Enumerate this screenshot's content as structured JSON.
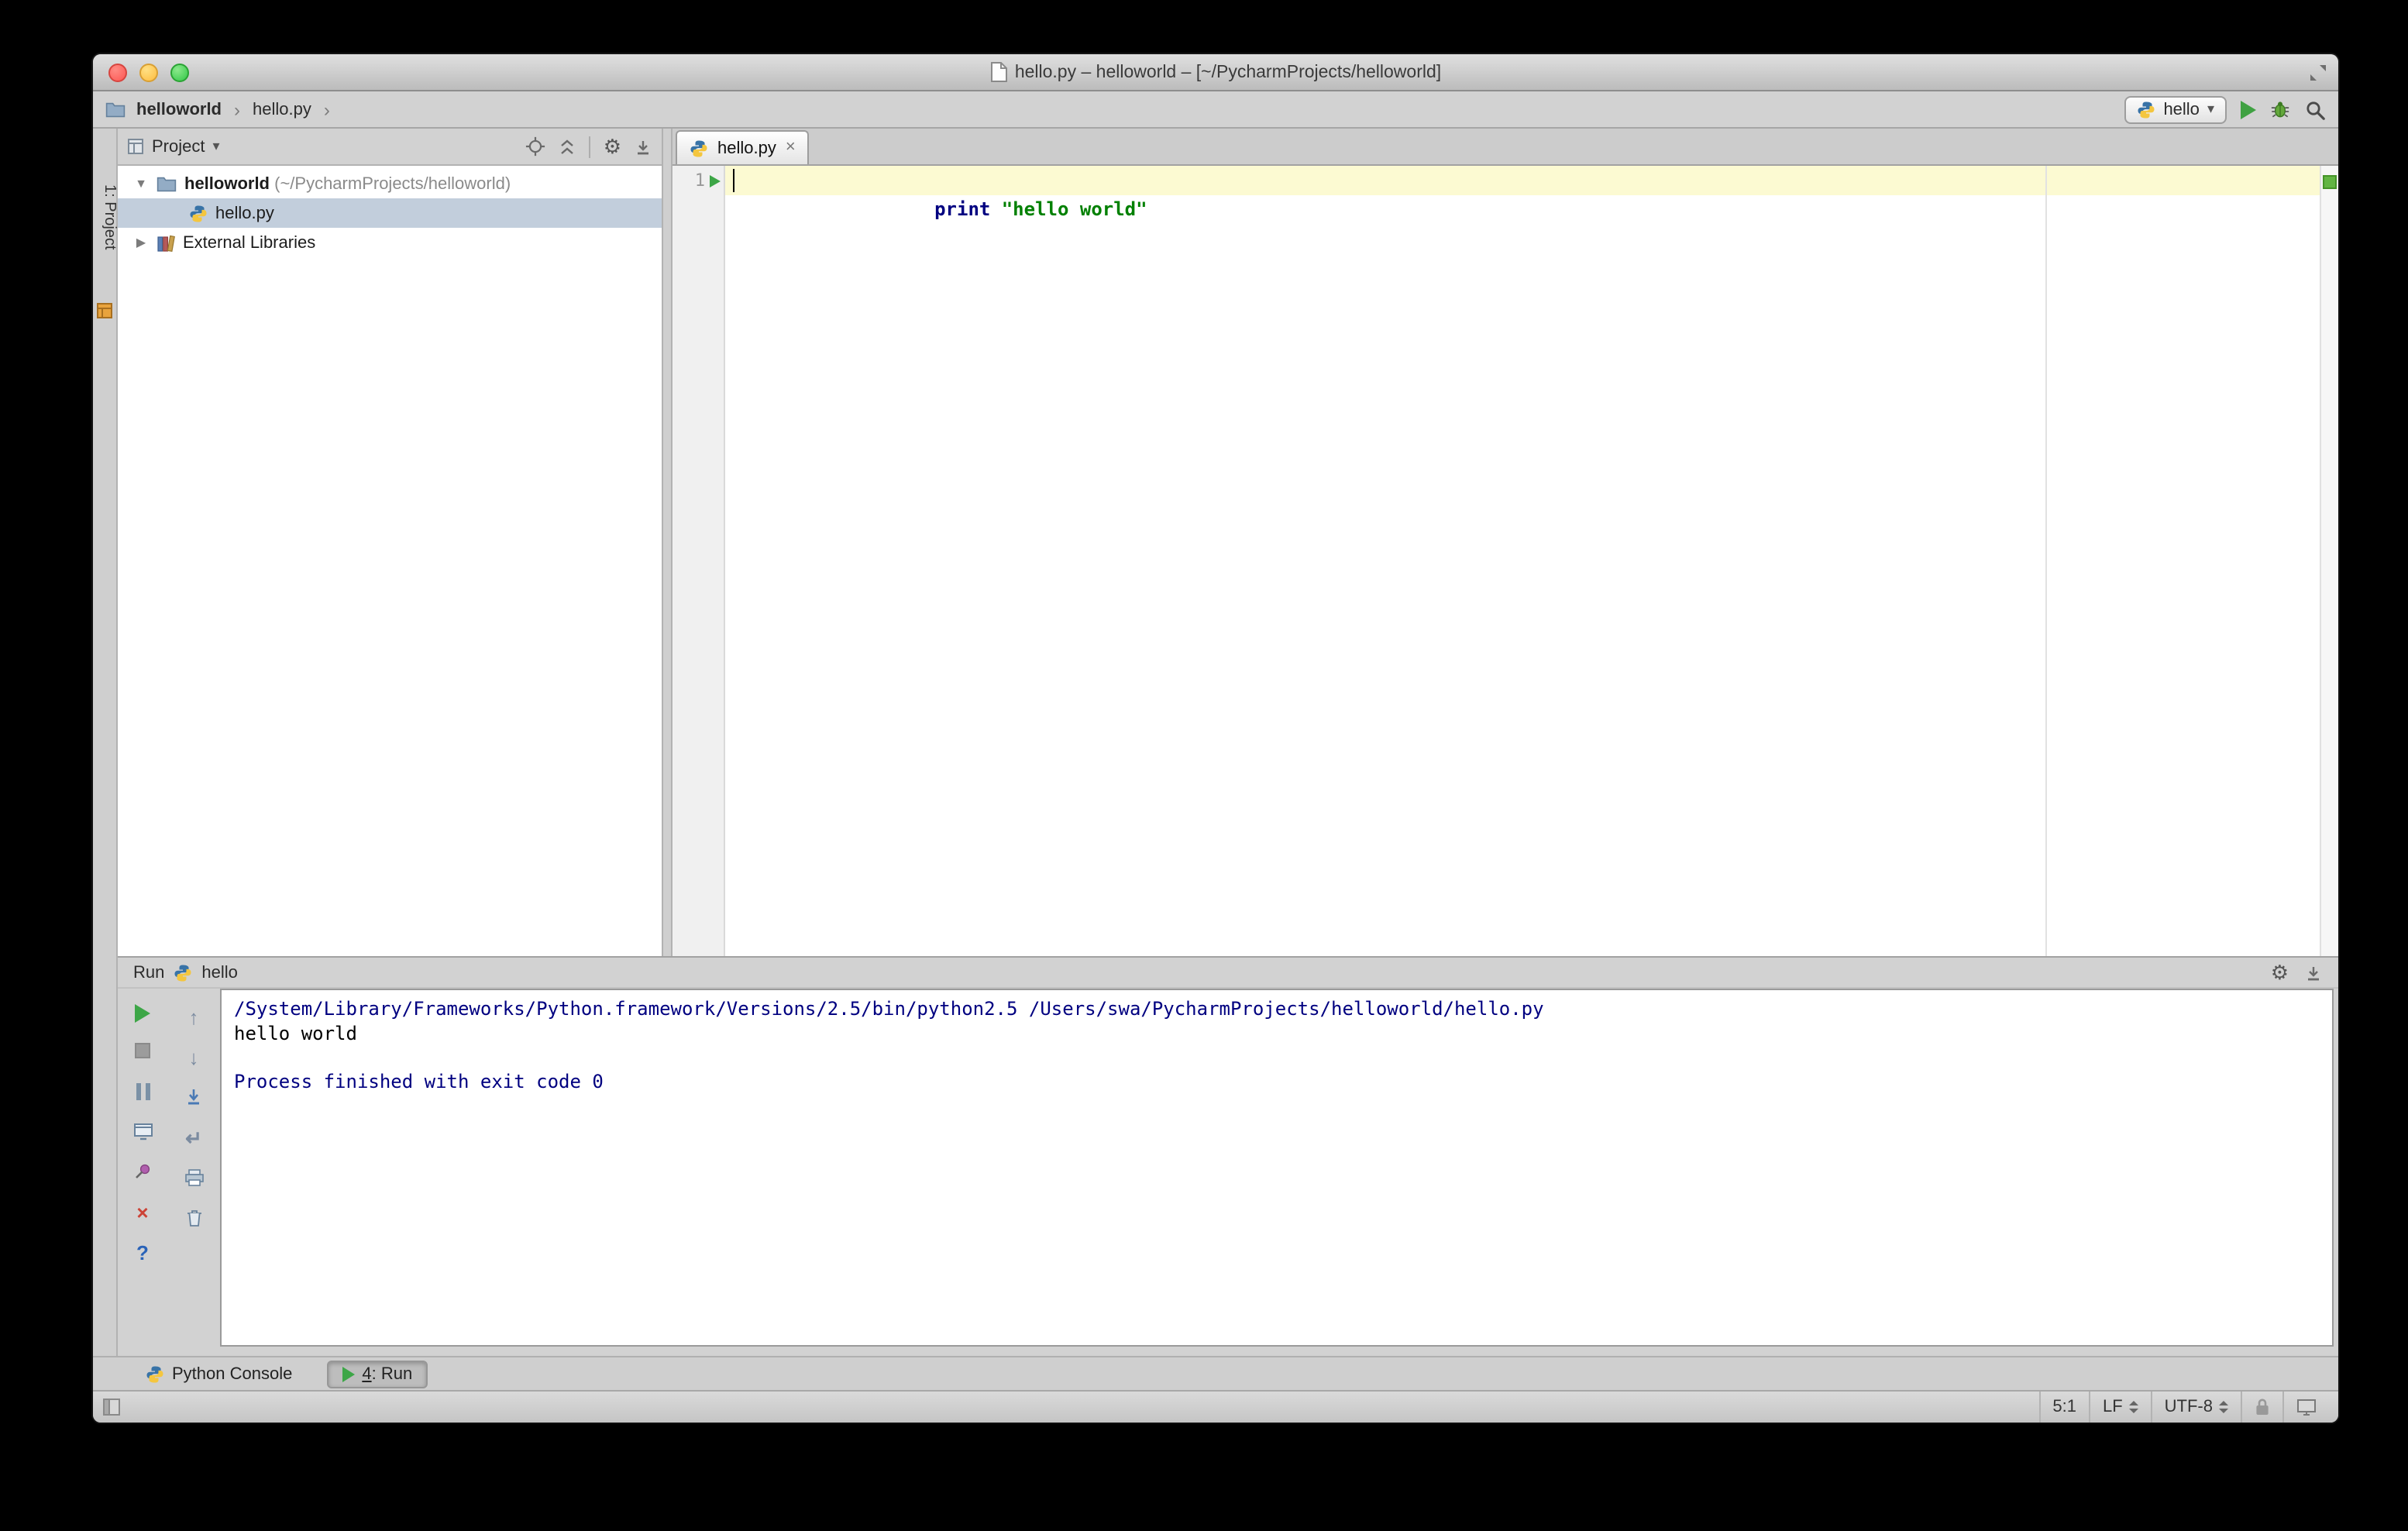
{
  "window": {
    "title": "hello.py – helloworld – [~/PycharmProjects/helloworld]"
  },
  "navbar": {
    "breadcrumbs": [
      "helloworld",
      "hello.py"
    ],
    "separator": "›",
    "run_config": "hello"
  },
  "tool_strip": {
    "project_button": "1: Project"
  },
  "project_panel": {
    "mode": "Project",
    "tree": {
      "root_name": "helloworld",
      "root_path": " (~/PycharmProjects/helloworld)",
      "file": "hello.py",
      "libraries": "External Libraries"
    }
  },
  "editor": {
    "tab": "hello.py",
    "line_number": "1",
    "keyword": "print",
    "string": "\"hello world\""
  },
  "run_panel": {
    "title": "Run",
    "config": "hello",
    "console": [
      "/System/Library/Frameworks/Python.framework/Versions/2.5/bin/python2.5 /Users/swa/PycharmProjects/helloworld/hello.py",
      "hello world",
      "",
      "Process finished with exit code 0"
    ]
  },
  "bottom_bar": {
    "python_console": "Python Console",
    "run_tab_number": "4",
    "run_tab_rest": ": Run"
  },
  "status_bar": {
    "caret": "5:1",
    "line_separator": "LF",
    "encoding": "UTF-8"
  },
  "icons": {
    "chevron": "›",
    "dropdown": "▾",
    "collapsed": "▶",
    "expanded": "▼",
    "close": "×",
    "help": "?",
    "gear": "⚙",
    "up": "↑",
    "down": "↓",
    "softwrap": "↵"
  }
}
